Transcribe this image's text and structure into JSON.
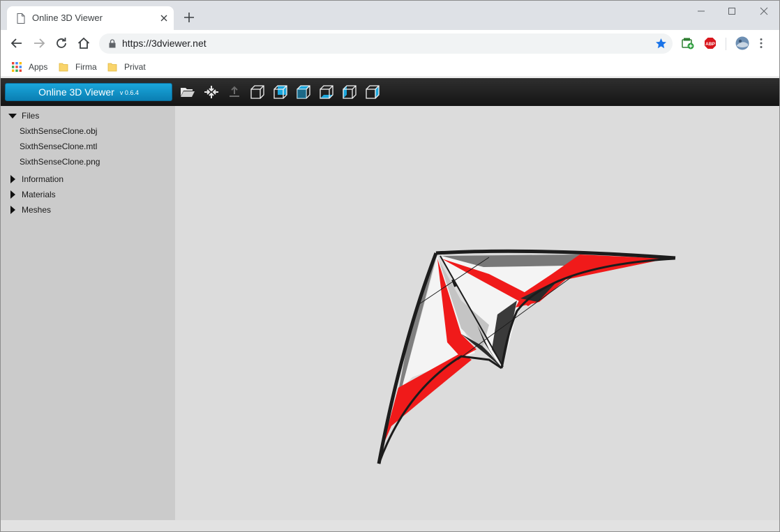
{
  "browser": {
    "tab": {
      "title": "Online 3D Viewer"
    },
    "address": {
      "url": "https://3dviewer.net"
    },
    "bookmarks": [
      {
        "label": "Apps",
        "icon": "apps-grid-icon"
      },
      {
        "label": "Firma",
        "icon": "folder-icon"
      },
      {
        "label": "Privat",
        "icon": "folder-icon"
      }
    ],
    "extensions": [
      "screenshot-extension-icon",
      "adblock-icon",
      "profile-avatar-icon"
    ]
  },
  "app": {
    "title": "Online 3D Viewer",
    "version": "v 0.6.4",
    "toolbar_icons": [
      "open-folder-icon",
      "fit-to-window-icon",
      "set-up-vector-icon",
      "front-view-icon",
      "back-view-icon",
      "top-view-icon",
      "bottom-view-icon",
      "left-view-icon",
      "right-view-icon"
    ],
    "accent_color": "#0a8fc7"
  },
  "sidebar": {
    "files": {
      "label": "Files",
      "expanded": true,
      "items": [
        "SixthSenseClone.obj",
        "SixthSenseClone.mtl",
        "SixthSenseClone.png"
      ]
    },
    "information": {
      "label": "Information",
      "expanded": false
    },
    "materials": {
      "label": "Materials",
      "expanded": false
    },
    "meshes": {
      "label": "Meshes",
      "expanded": false
    }
  },
  "viewer": {
    "model": "kite-model",
    "colors": {
      "red": "#f01a1a",
      "dark": "#1c1c1c",
      "grey": "#7a7a7a",
      "light": "#f2f2f2",
      "background": "#dcdcdc"
    }
  }
}
